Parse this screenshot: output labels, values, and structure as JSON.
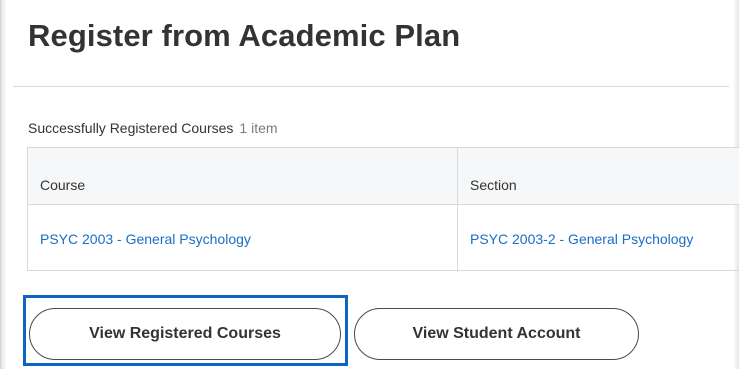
{
  "page": {
    "title": "Register from Academic Plan"
  },
  "registered_courses": {
    "header": "Successfully Registered Courses",
    "count": "1 item",
    "columns": [
      "Course",
      "Section"
    ],
    "rows": [
      {
        "course": "PSYC 2003 - General Psychology",
        "section": "PSYC 2003-2 - General Psychology"
      }
    ]
  },
  "actions": {
    "view_registered_label": "View Registered Courses",
    "view_account_label": "View Student Account"
  },
  "colors": {
    "link": "#1a6ec5",
    "focus_outline": "#0b66c3",
    "text": "#333333"
  }
}
